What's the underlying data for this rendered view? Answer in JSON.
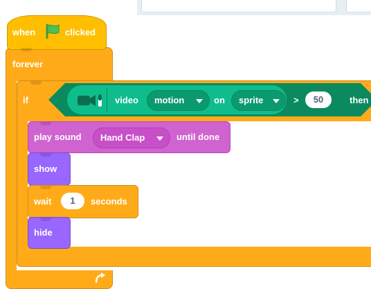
{
  "hat": {
    "prefix": "when",
    "icon": "green-flag-icon",
    "suffix": "clicked"
  },
  "forever": {
    "label": "forever",
    "loop_icon": "loop-arrow-icon"
  },
  "if_block": {
    "label": "if",
    "then": "then",
    "condition": {
      "icon": "video-sensing-icon",
      "label": "video",
      "attribute": "motion",
      "connector": "on",
      "target": "sprite",
      "operator": ">",
      "value": "50"
    }
  },
  "blocks": {
    "play_sound": {
      "prefix": "play sound",
      "sound": "Hand Clap",
      "suffix": "until done"
    },
    "show": "show",
    "wait": {
      "prefix": "wait",
      "value": "1",
      "suffix": "seconds"
    },
    "hide": "hide"
  },
  "colors": {
    "events": "#ffbf00",
    "control": "#ffab19",
    "video_sensing": "#0fbd8c",
    "sound": "#cf63cf",
    "looks": "#9966ff"
  }
}
